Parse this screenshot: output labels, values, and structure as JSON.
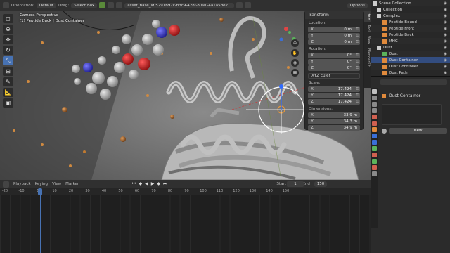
{
  "header": {
    "orientation_label": "Orientation:",
    "orientation_value": "Default",
    "drag_label": "Drag:",
    "drag_value": "Select Box",
    "file_name": "asset_base_id:5291b92c-b3c9-428f-8091-4a1a5de2...",
    "options_label": "Options"
  },
  "viewport": {
    "info_line1": "Camera Perspective",
    "info_line2": "(1) Peptide Back | Dust Container"
  },
  "npanel": {
    "title": "Transform",
    "location_label": "Location:",
    "location": [
      {
        "axis": "X",
        "value": "0 m"
      },
      {
        "axis": "Y",
        "value": "0 m"
      },
      {
        "axis": "Z",
        "value": "0 m"
      }
    ],
    "rotation_label": "Rotation:",
    "rotation": [
      {
        "axis": "X",
        "value": "0°"
      },
      {
        "axis": "Y",
        "value": "0°"
      },
      {
        "axis": "Z",
        "value": "0°"
      }
    ],
    "rotation_mode": "XYZ Euler",
    "scale_label": "Scale:",
    "scale": [
      {
        "axis": "X",
        "value": "17.424"
      },
      {
        "axis": "Y",
        "value": "17.424"
      },
      {
        "axis": "Z",
        "value": "17.424"
      }
    ],
    "dimensions_label": "Dimensions:",
    "dimensions": [
      {
        "axis": "X",
        "value": "33.9 m"
      },
      {
        "axis": "Y",
        "value": "34.3 m"
      },
      {
        "axis": "Z",
        "value": "34.9 m"
      }
    ],
    "tabs": [
      "Item",
      "Tool",
      "View",
      "BlenderKit"
    ]
  },
  "outliner": {
    "rows": [
      {
        "label": "Scene Collection",
        "indent": 2,
        "color": "#cccccc",
        "sel": false
      },
      {
        "label": "Collection",
        "indent": 8,
        "color": "#cccccc",
        "sel": false
      },
      {
        "label": "Complex",
        "indent": 8,
        "color": "#cccccc",
        "sel": false
      },
      {
        "label": "Peptide Bound",
        "indent": 16,
        "color": "#e08a3c",
        "sel": false
      },
      {
        "label": "Peptide Front",
        "indent": 16,
        "color": "#e08a3c",
        "sel": false
      },
      {
        "label": "Peptide Back",
        "indent": 16,
        "color": "#e08a3c",
        "sel": false
      },
      {
        "label": "MHC",
        "indent": 16,
        "color": "#e08a3c",
        "sel": false
      },
      {
        "label": "Dust",
        "indent": 8,
        "color": "#cccccc",
        "sel": false
      },
      {
        "label": "Dust",
        "indent": 16,
        "color": "#5bb35b",
        "sel": false
      },
      {
        "label": "Dust Container",
        "indent": 16,
        "color": "#e08a3c",
        "sel": true
      },
      {
        "label": "Dust Controller",
        "indent": 16,
        "color": "#e08a3c",
        "sel": false
      },
      {
        "label": "Dust Path",
        "indent": 16,
        "color": "#e08a3c",
        "sel": false
      }
    ]
  },
  "properties": {
    "object_name": "Dust Container",
    "new_button": "New"
  },
  "timeline": {
    "playback_label": "Playback",
    "keying_label": "Keying",
    "view_label": "View",
    "marker_label": "Marker",
    "current_frame": "1",
    "start_label": "Start",
    "start_value": "1",
    "end_label": "End",
    "end_value": "150",
    "ticks": [
      "-20",
      "-10",
      "1",
      "10",
      "20",
      "30",
      "40",
      "50",
      "60",
      "70",
      "80",
      "90",
      "100",
      "110",
      "120",
      "130",
      "140",
      "150"
    ]
  },
  "colors": {
    "accent": "#4772b3",
    "viewport_bg": "#6a6a6a",
    "selection_orange": "#f29b34"
  },
  "icons": [
    "cursor-icon",
    "move-icon",
    "rotate-icon",
    "scale-icon",
    "transform-icon",
    "annotate-icon",
    "measure-icon",
    "add-cube-icon",
    "eye-icon",
    "camera-icon",
    "play-icon"
  ]
}
